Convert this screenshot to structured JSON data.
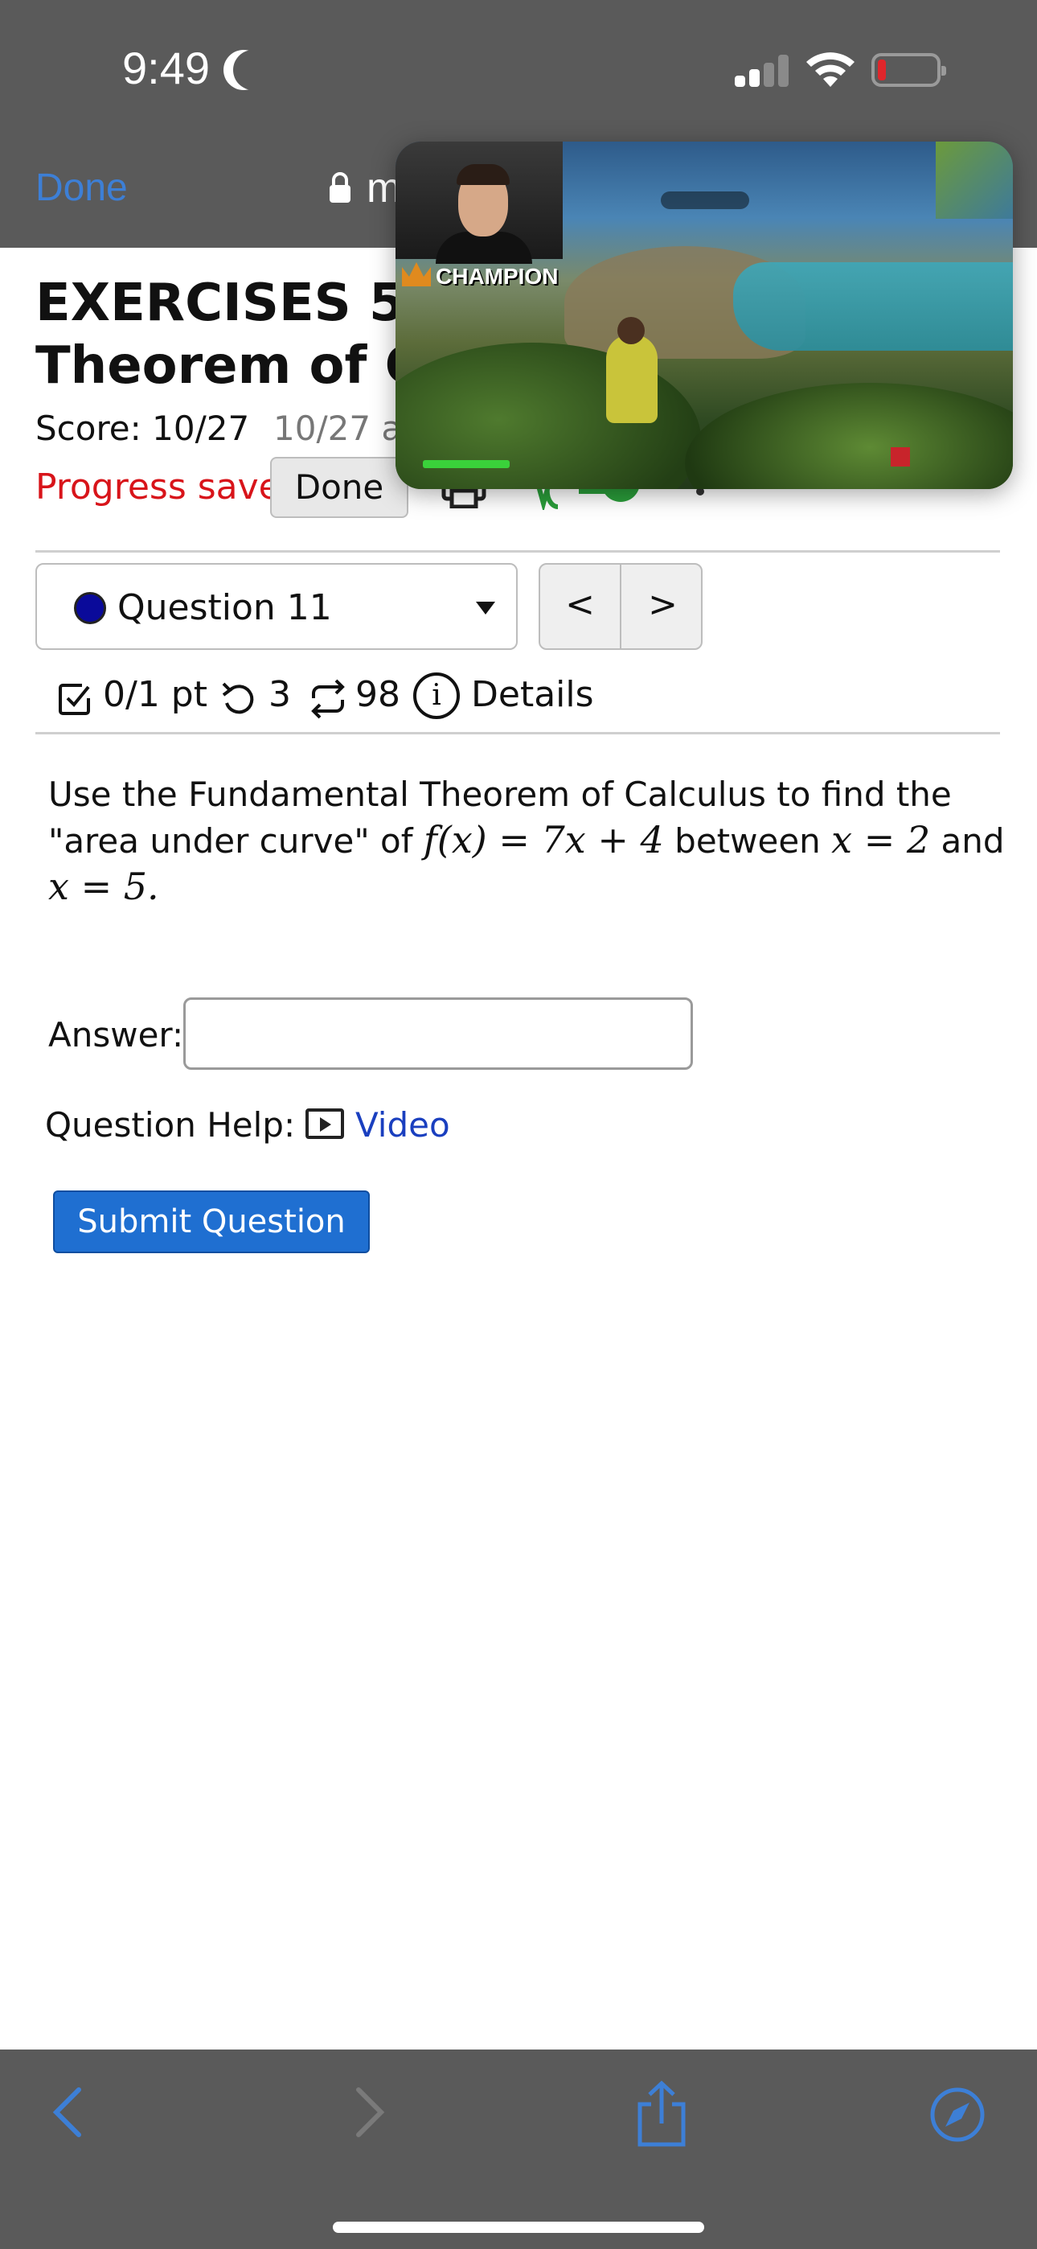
{
  "status_bar": {
    "time": "9:49"
  },
  "browser": {
    "done_label": "Done",
    "url_fragment": "m"
  },
  "page": {
    "title_line1": "EXERCISES 5.3",
    "title_line2": "Theorem of Ca",
    "score_label": "Score: 10/27",
    "score_secondary": "10/27 a",
    "progress_status": "Progress saved",
    "done_button": "Done"
  },
  "question_nav": {
    "selected_question": "Question 11",
    "prev_label": "<",
    "next_label": ">"
  },
  "question_meta": {
    "points": "0/1 pt",
    "retries": "3",
    "attempts": "98",
    "details_label": "Details"
  },
  "question": {
    "text_intro": "Use the Fundamental Theorem of Calculus to find the \"area under curve\" of",
    "function": "f(x) = 7x + 4",
    "between_word": "between",
    "lower": "x = 2",
    "and_word": "and",
    "upper": "x = 5."
  },
  "answer": {
    "label": "Answer:",
    "value": "",
    "placeholder": ""
  },
  "help": {
    "label": "Question Help:",
    "video_label": "Video"
  },
  "submit": {
    "label": "Submit Question"
  },
  "pip_overlay": {
    "badge_text": "CHAMPION"
  },
  "colors": {
    "accent_link": "#3d7fd6",
    "progress_red": "#d8141a",
    "submit_blue": "#1f6fd1",
    "question_dot": "#0a0a9a"
  }
}
